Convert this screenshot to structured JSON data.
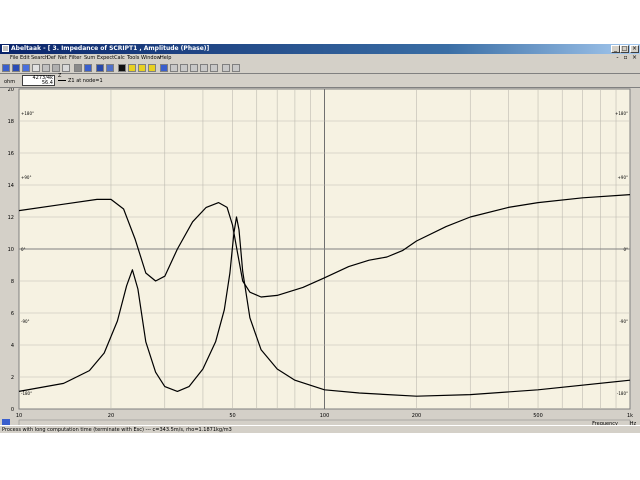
{
  "window": {
    "app_title": "Abeltaak",
    "doc_title": "- [ 3. Impedance of SCRIPT1 , Amplitude (Phase)]"
  },
  "menu": [
    "File",
    "Edit",
    "Search",
    "Def",
    "Net",
    "Filter",
    "Sum",
    "Expect",
    "Calc",
    "Tools",
    "Window",
    "Help"
  ],
  "probe": {
    "line1": "4273/4k",
    "line2": "56.4"
  },
  "legend": {
    "marker": "Z",
    "label": "Z1 at node=1"
  },
  "y_unit_label": "ohm",
  "x_unit_label": "Hz",
  "x_axis_name": "Frequency",
  "status": {
    "message": "Process with long computation time (terminate with Esc)  ---  c=343.5m/s, rho=1.1871kg/m3"
  },
  "chart_data": {
    "type": "line",
    "x_scale": "log",
    "xlim": [
      10,
      1000
    ],
    "ylim": [
      0,
      20
    ],
    "y_ticks": [
      0,
      2,
      4,
      6,
      8,
      10,
      12,
      14,
      16,
      18,
      20
    ],
    "x_tick_labels": [
      {
        "x": 10,
        "label": "10"
      },
      {
        "x": 20,
        "label": "20"
      },
      {
        "x": 50,
        "label": "50"
      },
      {
        "x": 100,
        "label": "100"
      },
      {
        "x": 200,
        "label": "200"
      },
      {
        "x": 500,
        "label": "500"
      },
      {
        "x": 1000,
        "label": "1k"
      }
    ],
    "phase_marks_right": [
      {
        "y": 18.5,
        "label": "+180°"
      },
      {
        "y": 14.5,
        "label": "+90°"
      },
      {
        "y": 10,
        "label": "0°"
      },
      {
        "y": 5.5,
        "label": "-90°"
      },
      {
        "y": 1,
        "label": "-180°"
      }
    ],
    "phase_marks_left": [
      {
        "y": 18.5,
        "label": "+180°"
      },
      {
        "y": 14.5,
        "label": "+90°"
      },
      {
        "y": 10,
        "label": "0°"
      },
      {
        "y": 5.5,
        "label": "-90°"
      },
      {
        "y": 1,
        "label": "-180°"
      }
    ],
    "series": [
      {
        "name": "Z1 at node=1",
        "points": [
          [
            10,
            1.1
          ],
          [
            14,
            1.6
          ],
          [
            17,
            2.4
          ],
          [
            19,
            3.5
          ],
          [
            21,
            5.5
          ],
          [
            22.5,
            7.7
          ],
          [
            23.5,
            8.7
          ],
          [
            24.5,
            7.5
          ],
          [
            26,
            4.2
          ],
          [
            28,
            2.3
          ],
          [
            30,
            1.4
          ],
          [
            33,
            1.1
          ],
          [
            36,
            1.4
          ],
          [
            40,
            2.5
          ],
          [
            44,
            4.2
          ],
          [
            47,
            6.2
          ],
          [
            49,
            8.5
          ],
          [
            50.5,
            11
          ],
          [
            51.5,
            12
          ],
          [
            52.5,
            11.2
          ],
          [
            54,
            8.6
          ],
          [
            57,
            5.7
          ],
          [
            62,
            3.7
          ],
          [
            70,
            2.5
          ],
          [
            80,
            1.8
          ],
          [
            100,
            1.2
          ],
          [
            130,
            1.0
          ],
          [
            200,
            0.8
          ],
          [
            300,
            0.9
          ],
          [
            500,
            1.2
          ],
          [
            1000,
            1.8
          ]
        ]
      },
      {
        "name": "Phase",
        "points": [
          [
            10,
            12.4
          ],
          [
            14,
            12.8
          ],
          [
            18,
            13.1
          ],
          [
            20,
            13.1
          ],
          [
            22,
            12.5
          ],
          [
            24,
            10.6
          ],
          [
            26,
            8.5
          ],
          [
            28,
            8.0
          ],
          [
            30,
            8.3
          ],
          [
            33,
            10.0
          ],
          [
            37,
            11.7
          ],
          [
            41,
            12.6
          ],
          [
            45,
            12.9
          ],
          [
            48,
            12.6
          ],
          [
            50,
            11.5
          ],
          [
            52,
            9.7
          ],
          [
            54,
            8.0
          ],
          [
            57,
            7.3
          ],
          [
            62,
            7.0
          ],
          [
            70,
            7.1
          ],
          [
            85,
            7.6
          ],
          [
            100,
            8.2
          ],
          [
            120,
            8.9
          ],
          [
            140,
            9.3
          ],
          [
            160,
            9.5
          ],
          [
            180,
            9.9
          ],
          [
            200,
            10.5
          ],
          [
            250,
            11.4
          ],
          [
            300,
            12.0
          ],
          [
            400,
            12.6
          ],
          [
            500,
            12.9
          ],
          [
            700,
            13.2
          ],
          [
            1000,
            13.4
          ]
        ]
      }
    ]
  }
}
